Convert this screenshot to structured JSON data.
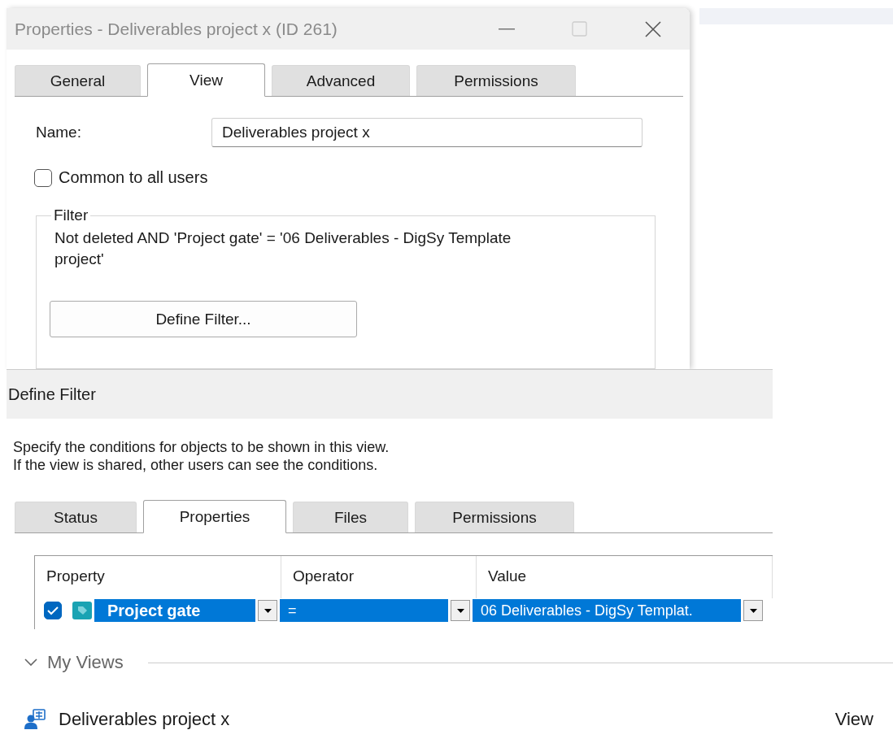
{
  "properties_window": {
    "title": "Properties - Deliverables project x (ID 261)",
    "tabs": [
      {
        "label": "General",
        "selected": false
      },
      {
        "label": "View",
        "selected": true
      },
      {
        "label": "Advanced",
        "selected": false
      },
      {
        "label": "Permissions",
        "selected": false
      }
    ],
    "name_label": "Name:",
    "name_value": "Deliverables project x",
    "common_checkbox": {
      "label": "Common to all users",
      "checked": false
    },
    "filter_group": {
      "legend": "Filter",
      "description": "Not deleted AND 'Project gate' = '06 Deliverables - DigSy Template project'",
      "button": "Define Filter..."
    }
  },
  "define_filter": {
    "title": "Define Filter",
    "instructions": [
      "Specify the conditions for objects to be shown in this view.",
      "If the view is shared, other users can see the conditions."
    ],
    "tabs": [
      {
        "label": "Status",
        "selected": false
      },
      {
        "label": "Properties",
        "selected": true
      },
      {
        "label": "Files",
        "selected": false
      },
      {
        "label": "Permissions",
        "selected": false
      }
    ],
    "table": {
      "columns": [
        "Property",
        "Operator",
        "Value"
      ],
      "rows": [
        {
          "checked": true,
          "selected": true,
          "property": "Project gate",
          "operator": "=",
          "value": "06 Deliverables - DigSy Templat."
        }
      ]
    }
  },
  "my_views": {
    "header": "My Views",
    "expanded": true,
    "items": [
      {
        "name": "Deliverables project x",
        "type": "View"
      }
    ]
  }
}
